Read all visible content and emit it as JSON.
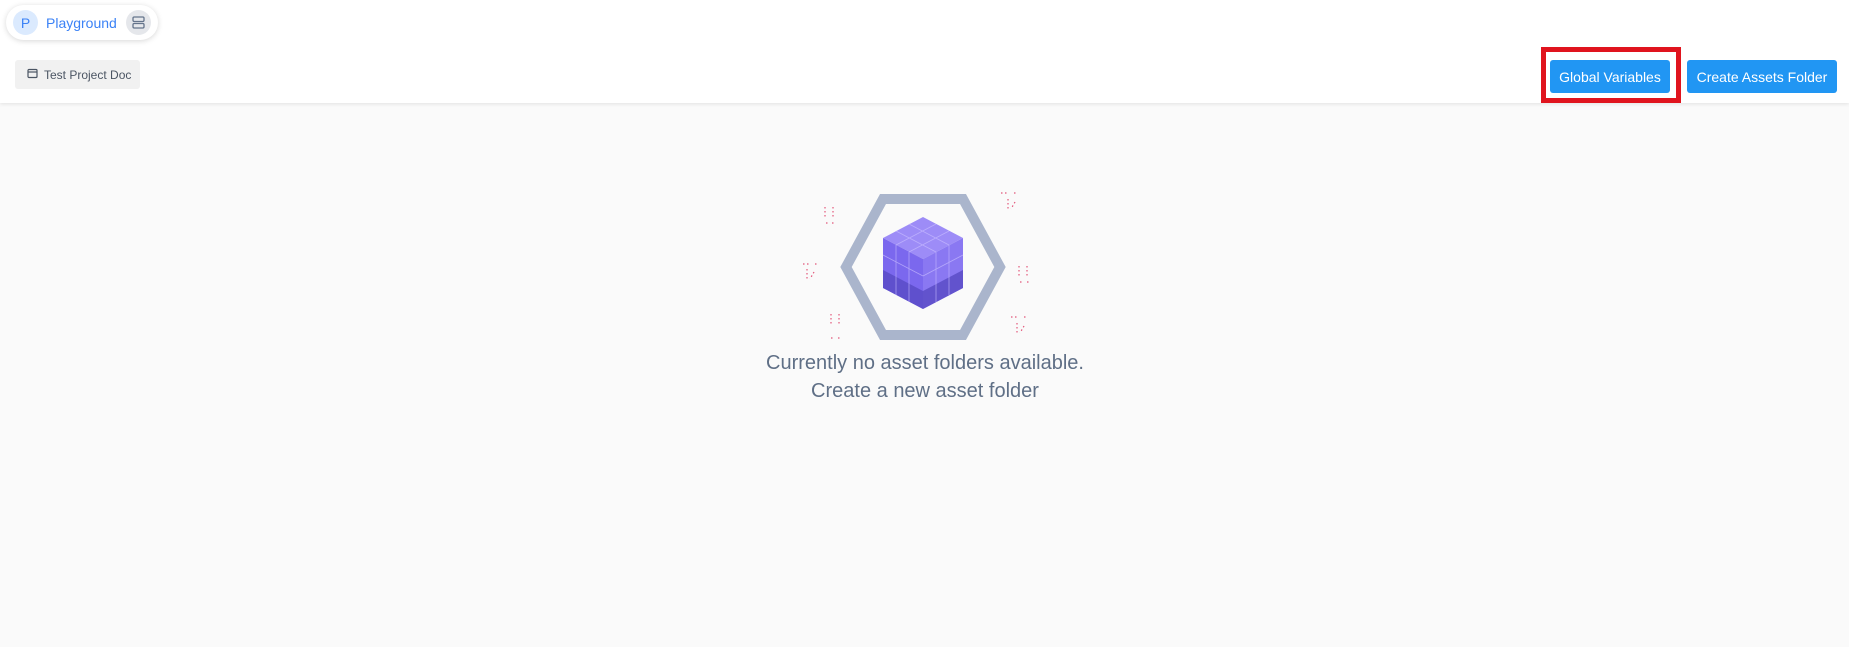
{
  "workspace": {
    "avatar_letter": "P",
    "name": "Playground",
    "switch_icon": "server-stack-icon"
  },
  "project": {
    "label": "Test Project Doc",
    "icon": "document-icon"
  },
  "toolbar": {
    "global_variables_label": "Global Variables",
    "create_folder_label": "Create Assets Folder"
  },
  "empty_state": {
    "illustration_icon": "cube-hexagon-icon",
    "line1": "Currently no asset folders available.",
    "line2": "Create a new asset folder"
  },
  "colors": {
    "accent": "#2196f3",
    "highlight": "#e0141e",
    "hexagon": "#aab5cc",
    "cube": "#7b68ee",
    "sparkle": "#e2577a"
  }
}
